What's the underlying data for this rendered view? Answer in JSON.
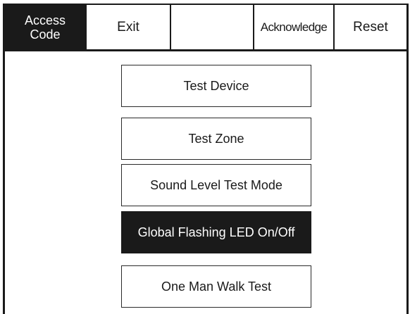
{
  "toolbar": {
    "access_code_label": "Access\nCode",
    "exit_label": "Exit",
    "blank_label": "",
    "acknowledge_label": "Acknowledge",
    "reset_label": "Reset"
  },
  "menu": {
    "items": [
      {
        "label": "Test Device",
        "selected": false
      },
      {
        "label": "Test Zone",
        "selected": false
      },
      {
        "label": "Sound Level Test Mode",
        "selected": false
      },
      {
        "label": "Global Flashing LED On/Off",
        "selected": true
      },
      {
        "label": "One Man Walk Test",
        "selected": false
      }
    ]
  },
  "colors": {
    "foreground": "#1a1a1a",
    "background": "#ffffff",
    "selected_background": "#1a1a1a",
    "selected_text": "#ffffff"
  }
}
